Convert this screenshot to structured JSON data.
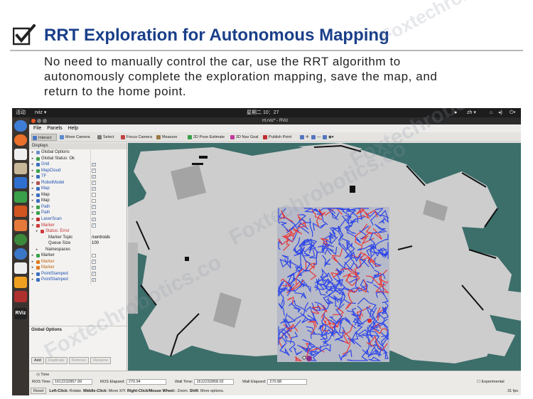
{
  "header": {
    "title": "RRT Exploration for Autonomous Mapping",
    "description_lines": [
      "No need to manually control the car, use the RRT algorithm to",
      "autonomously complete the exploration mapping, save the map, and",
      "return to the home point."
    ]
  },
  "topbar": {
    "activities": "活动",
    "app_menu": "rviz ▾",
    "clock": "星期二 10：27",
    "input_method": "zh ▾"
  },
  "window": {
    "title": "rrt.rviz* - RViz"
  },
  "menu": [
    "File",
    "Panels",
    "Help"
  ],
  "toolbar": [
    {
      "label": "Interact",
      "color": "#4a76c2",
      "active": true
    },
    {
      "label": "Move Camera",
      "color": "#5f8bd0",
      "active": false
    },
    {
      "label": "Select",
      "color": "#7a7a7a",
      "active": false
    },
    {
      "label": "Focus Camera",
      "color": "#c04040",
      "active": false
    },
    {
      "label": "Measure",
      "color": "#9a7a40",
      "active": false
    },
    {
      "label": "2D Pose Estimate",
      "color": "#3aa04a",
      "active": false
    },
    {
      "label": "2D Nav Goal",
      "color": "#c03a9a",
      "active": false
    },
    {
      "label": "Publish Point",
      "color": "#c03030",
      "active": false
    },
    {
      "label": "✛",
      "color": "#5575c0",
      "active": false
    },
    {
      "label": "—",
      "color": "#5575c0",
      "active": false
    },
    {
      "label": "◉▾",
      "color": "#5575c0",
      "active": false
    }
  ],
  "displays": {
    "header": "Displays",
    "rows": [
      {
        "arrow": "▸",
        "indent": 0,
        "icon": "#6c8fc9",
        "label": "Global Options",
        "value": "",
        "check": null,
        "color": "#222"
      },
      {
        "arrow": "▸",
        "indent": 0,
        "icon": "#3aa04a",
        "label": "Global Status: Ok",
        "value": "",
        "check": null,
        "color": "#222"
      },
      {
        "arrow": "▸",
        "indent": 0,
        "icon": "#3b6fc0",
        "label": "Grid",
        "value": "",
        "check": true,
        "color": "#1f4fb0"
      },
      {
        "arrow": "▸",
        "indent": 0,
        "icon": "#3aa04a",
        "label": "MapCloud",
        "value": "",
        "check": true,
        "color": "#1f4fb0"
      },
      {
        "arrow": "▸",
        "indent": 0,
        "icon": "#3b6fc0",
        "label": "TF",
        "value": "",
        "check": true,
        "color": "#1f4fb0"
      },
      {
        "arrow": "▸",
        "indent": 0,
        "icon": "#b05050",
        "label": "RobotModel",
        "value": "",
        "check": true,
        "color": "#1f4fb0"
      },
      {
        "arrow": "▸",
        "indent": 0,
        "icon": "#3b6fc0",
        "label": "Map",
        "value": "",
        "check": true,
        "color": "#1f4fb0"
      },
      {
        "arrow": "▸",
        "indent": 0,
        "icon": "#3b6fc0",
        "label": "Map",
        "value": "",
        "check": false,
        "color": "#222"
      },
      {
        "arrow": "▸",
        "indent": 0,
        "icon": "#3b6fc0",
        "label": "Map",
        "value": "",
        "check": false,
        "color": "#222"
      },
      {
        "arrow": "▸",
        "indent": 0,
        "icon": "#3aa04a",
        "label": "Path",
        "value": "",
        "check": true,
        "color": "#1f4fb0"
      },
      {
        "arrow": "▸",
        "indent": 0,
        "icon": "#3aa04a",
        "label": "Path",
        "value": "",
        "check": true,
        "color": "#1f4fb0"
      },
      {
        "arrow": "▸",
        "indent": 0,
        "icon": "#c03030",
        "label": "LaserScan",
        "value": "",
        "check": true,
        "color": "#1f4fb0"
      },
      {
        "arrow": "▾",
        "indent": 0,
        "icon": "#d03a3a",
        "label": "Marker",
        "value": "",
        "check": true,
        "color": "#c03030"
      },
      {
        "arrow": "▸",
        "indent": 6,
        "icon": "#d03a3a",
        "label": "Status: Error",
        "value": "",
        "check": null,
        "color": "#c03030"
      },
      {
        "arrow": "",
        "indent": 10,
        "icon": "",
        "label": "Marker Topic",
        "value": "/centroids",
        "check": null,
        "color": "#222"
      },
      {
        "arrow": "",
        "indent": 10,
        "icon": "",
        "label": "Queue Size",
        "value": "100",
        "check": null,
        "color": "#222"
      },
      {
        "arrow": "▸",
        "indent": 6,
        "icon": "",
        "label": "Namespaces",
        "value": "",
        "check": null,
        "color": "#222"
      },
      {
        "arrow": "▸",
        "indent": 0,
        "icon": "#3aa04a",
        "label": "Marker",
        "value": "",
        "check": false,
        "color": "#222"
      },
      {
        "arrow": "▸",
        "indent": 0,
        "icon": "#e07a20",
        "label": "Marker",
        "value": "",
        "check": true,
        "color": "#c06010"
      },
      {
        "arrow": "▸",
        "indent": 0,
        "icon": "#e07a20",
        "label": "Marker",
        "value": "",
        "check": true,
        "color": "#c06010"
      },
      {
        "arrow": "▸",
        "indent": 0,
        "icon": "#3b6fc0",
        "label": "PointStamped",
        "value": "",
        "check": true,
        "color": "#1f4fb0"
      },
      {
        "arrow": "▸",
        "indent": 0,
        "icon": "#3b6fc0",
        "label": "PointStamped",
        "value": "",
        "check": true,
        "color": "#1f4fb0"
      }
    ],
    "global_options": "Global Options",
    "buttons": {
      "add": "Add",
      "duplicate": "Duplicate",
      "remove": "Remove",
      "rename": "Rename"
    }
  },
  "time": {
    "header": "Time",
    "ros_time_label": "ROS Time:",
    "ros_time": "1612232857.99",
    "ros_elapsed_label": "ROS Elapsed:",
    "ros_elapsed": "270.94",
    "wall_time_label": "Wall Time:",
    "wall_time": "1612232858.02",
    "wall_elapsed_label": "Wall Elapsed:",
    "wall_elapsed": "270.88",
    "experimental": "Experimental",
    "reset": "Reset",
    "hint_parts": [
      {
        "text": "Left-Click:",
        "bold": true
      },
      {
        "text": " Rotate. ",
        "bold": false
      },
      {
        "text": "Middle-Click:",
        "bold": true
      },
      {
        "text": " Move X/Y. ",
        "bold": false
      },
      {
        "text": "Right-Click/Mouse Wheel:",
        "bold": true
      },
      {
        "text": ": Zoom. ",
        "bold": false
      },
      {
        "text": "Shift",
        "bold": true
      },
      {
        "text": ": More options.",
        "bold": false
      }
    ],
    "fps": "31 fps"
  },
  "watermark": "Foxtechrobotics.co",
  "colors": {
    "title": "#1a3f8a",
    "map_bg": "#3c6e6a",
    "free_space": "#cdcdcd",
    "tree_blue": "#2f47e8",
    "tree_red": "#e83a3a"
  }
}
